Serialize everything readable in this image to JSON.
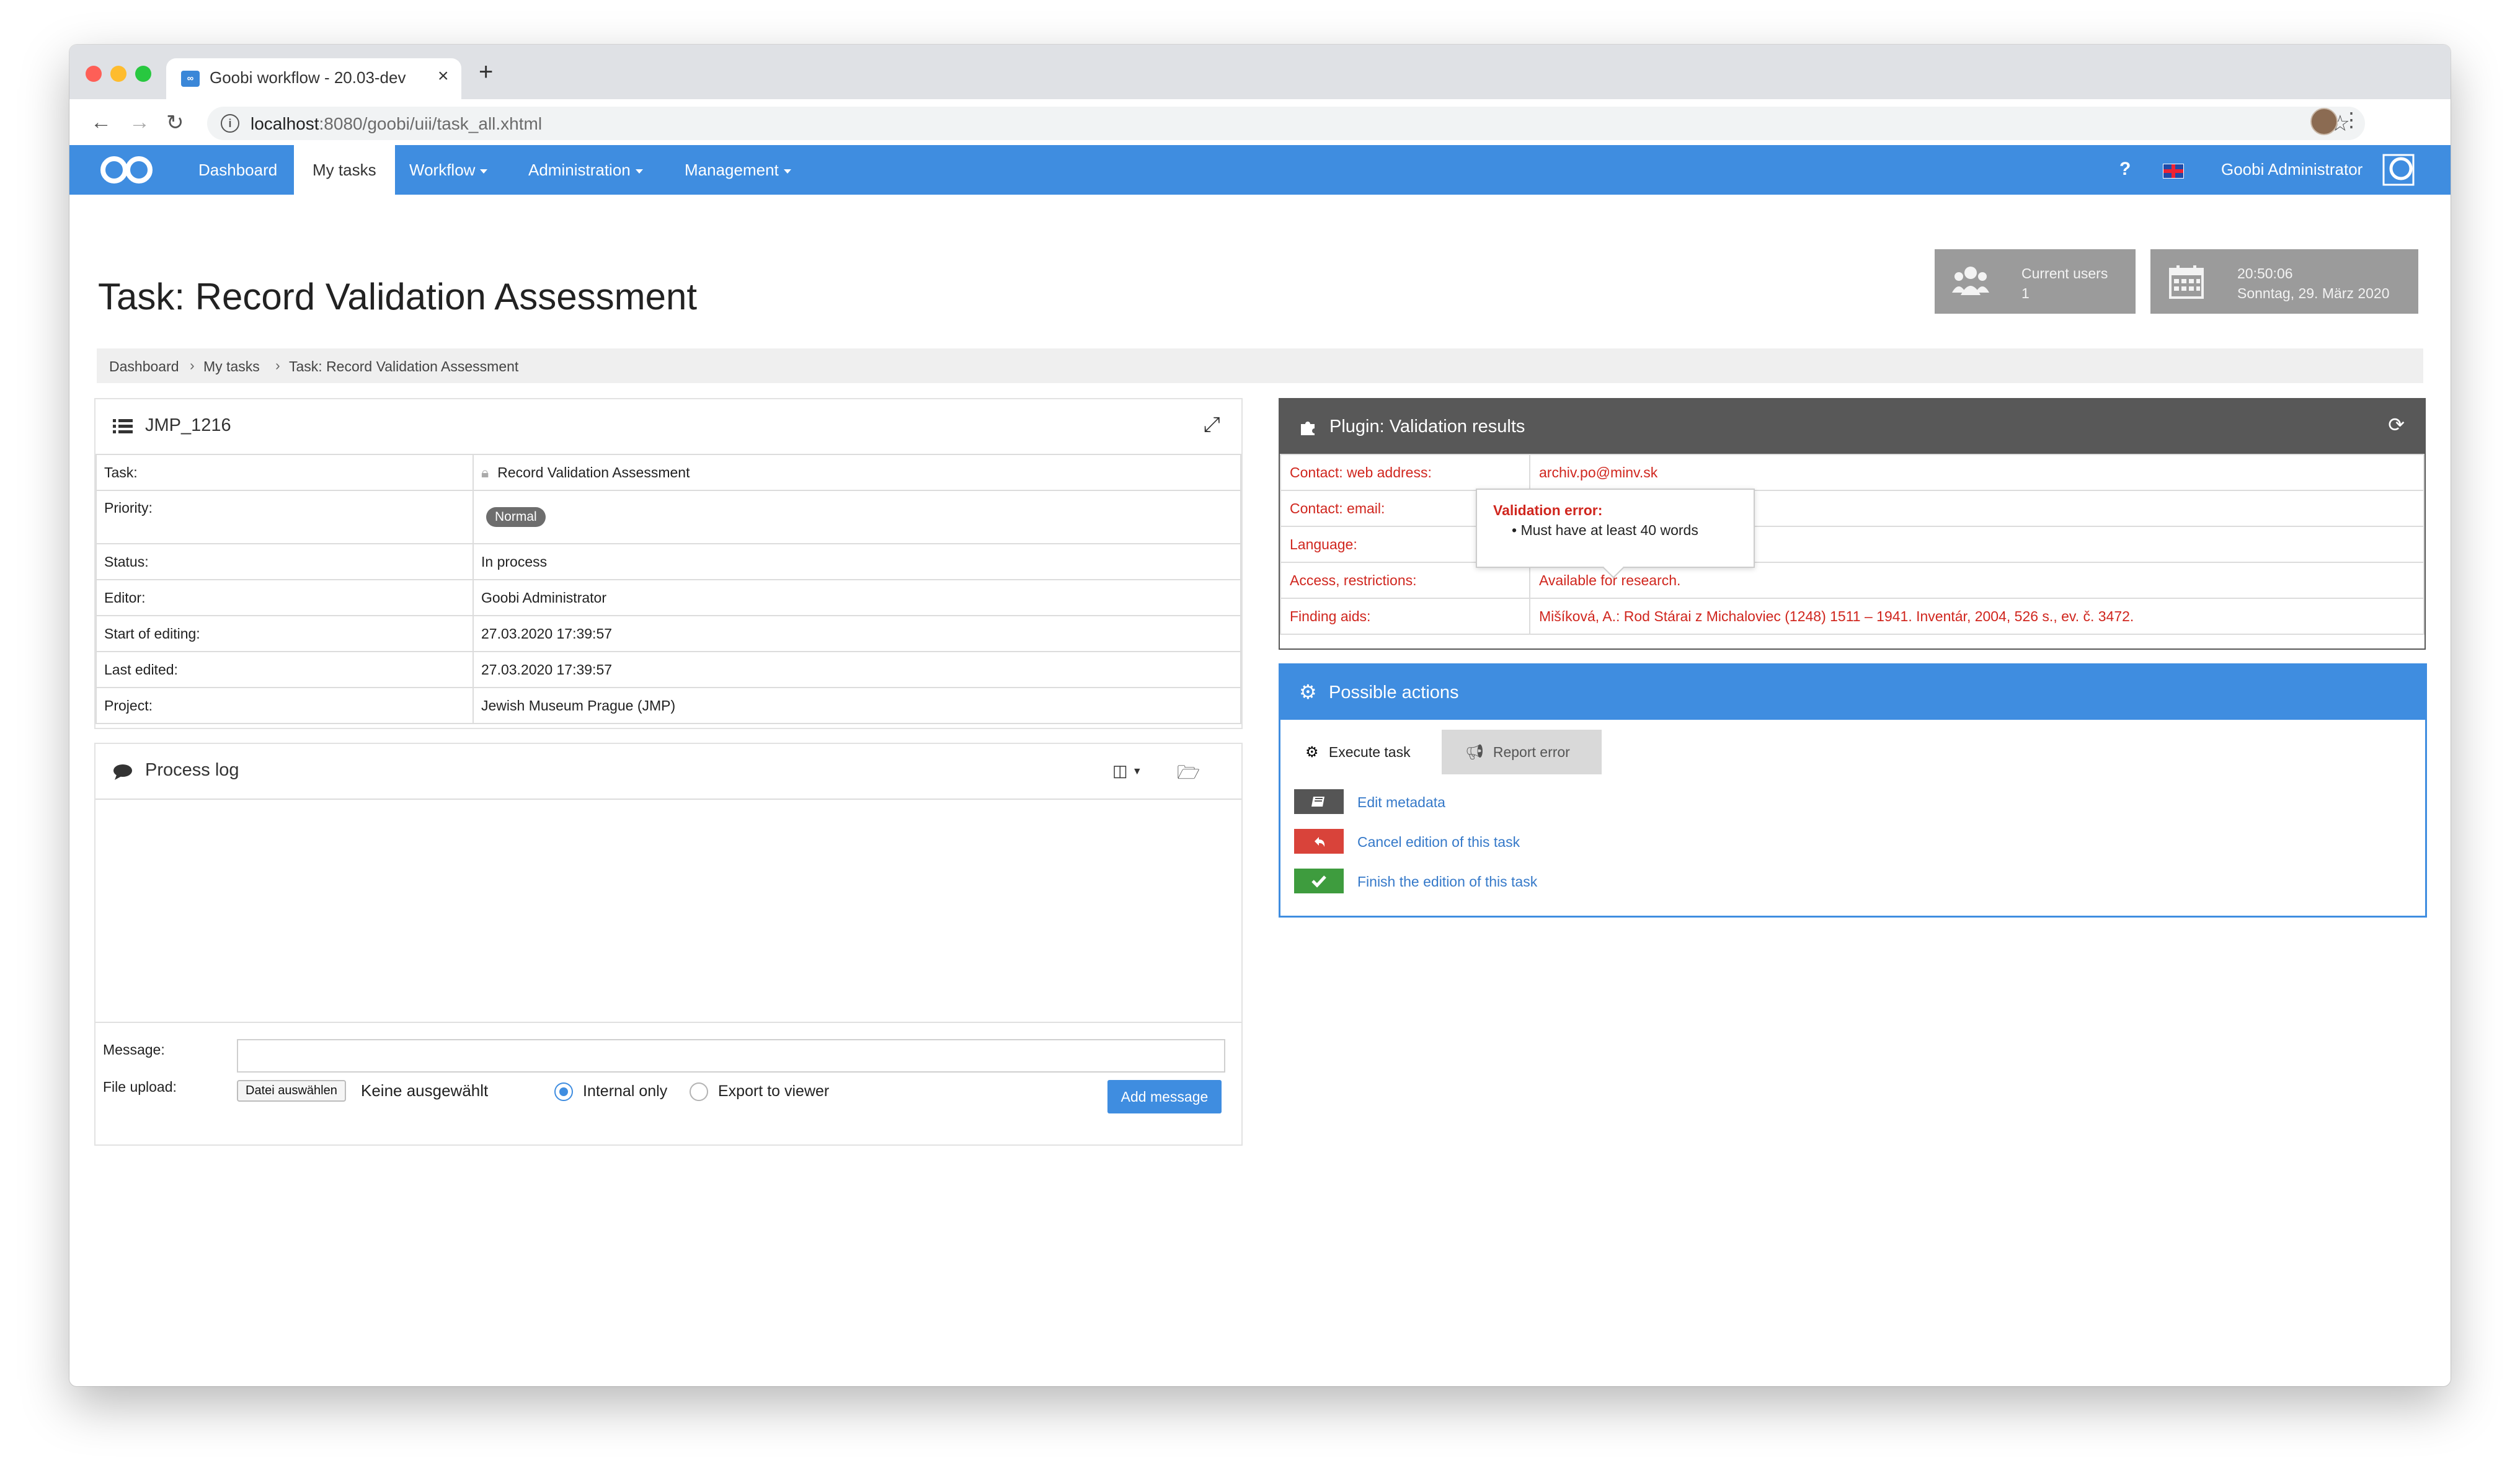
{
  "browser": {
    "tab_title": "Goobi workflow - 20.03-dev",
    "new_tab": "+",
    "close_tab": "×",
    "url_host": "localhost",
    "url_rest": ":8080/goobi/uii/task_all.xhtml",
    "favicon_text": "∞"
  },
  "navbar": {
    "items": [
      {
        "label": "Dashboard"
      },
      {
        "label": "My tasks"
      },
      {
        "label": "Workflow"
      },
      {
        "label": "Administration"
      },
      {
        "label": "Management"
      }
    ],
    "help": "?",
    "user": "Goobi Administrator",
    "accent": "#3f8de0"
  },
  "page": {
    "title": "Task: Record Validation Assessment"
  },
  "stats": {
    "users_label": "Current users",
    "users_value": "1",
    "time": "20:50:06",
    "date": "Sonntag, 29. März 2020"
  },
  "breadcrumb": [
    "Dashboard",
    "My tasks",
    "Task: Record Validation Assessment"
  ],
  "details": {
    "title": "JMP_1216",
    "rows": [
      {
        "label": "Task:",
        "value": "Record Validation Assessment"
      },
      {
        "label": "Priority:",
        "value": "Normal"
      },
      {
        "label": "Status:",
        "value": "In process"
      },
      {
        "label": "Editor:",
        "value": "Goobi Administrator"
      },
      {
        "label": "Start of editing:",
        "value": "27.03.2020 17:39:57"
      },
      {
        "label": "Last edited:",
        "value": "27.03.2020 17:39:57"
      },
      {
        "label": "Project:",
        "value": "Jewish Museum Prague (JMP)"
      }
    ]
  },
  "validation": {
    "title": "Plugin: Validation results",
    "error_color": "#d0261e",
    "rows": [
      {
        "label": "Contact: web address:",
        "value": "archiv.po@minv.sk"
      },
      {
        "label": "Contact: email:",
        "value": ""
      },
      {
        "label": "Language:",
        "value": ""
      },
      {
        "label": "Access, restrictions:",
        "value": "Available for research."
      },
      {
        "label": "Finding aids:",
        "value": "Mišíková, A.: Rod Stárai z Michaloviec (1248) 1511 – 1941. Inventár, 2004, 526 s., ev. č. 3472."
      }
    ],
    "tooltip_title": "Validation error:",
    "tooltip_item": "Must have at least 40 words"
  },
  "actions": {
    "title": "Possible actions",
    "tab_execute": "Execute task",
    "tab_report": "Report error",
    "items": [
      {
        "label": "Edit metadata",
        "icon": "book-icon",
        "color": "#555555"
      },
      {
        "label": "Cancel edition of this task",
        "icon": "undo-icon",
        "color": "#d9433a"
      },
      {
        "label": "Finish the edition of this task",
        "icon": "check-icon",
        "color": "#3e9c3e"
      }
    ]
  },
  "log": {
    "title": "Process log",
    "message_label": "Message:",
    "file_label": "File upload:",
    "file_button": "Datei auswählen",
    "file_none": "Keine ausgewählt",
    "radio_internal": "Internal only",
    "radio_export": "Export to viewer",
    "submit": "Add message"
  }
}
